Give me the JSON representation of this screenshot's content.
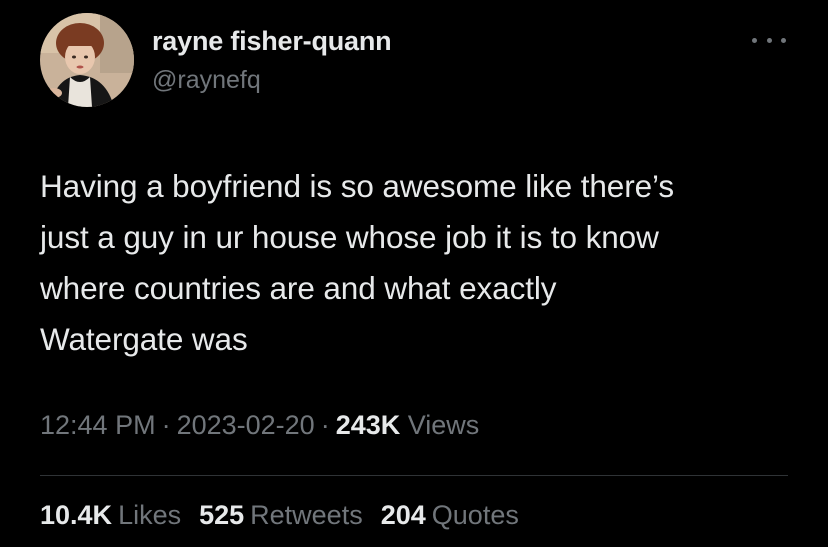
{
  "author": {
    "display_name": "rayne fisher-quann",
    "handle": "@raynefq",
    "avatar_icon": "profile-photo"
  },
  "more_icon": "ellipsis-icon",
  "tweet": {
    "lines": [
      "Having a boyfriend is so awesome like there’s",
      "just a guy in ur house whose job it is to know",
      "where countries are and what exactly",
      "Watergate was"
    ]
  },
  "meta": {
    "time": "12:44 PM",
    "separator": "·",
    "date": "2023-02-20",
    "views_count": "243K",
    "views_label": "Views"
  },
  "stats": {
    "likes_count": "10.4K",
    "likes_label": "Likes",
    "retweets_count": "525",
    "retweets_label": "Retweets",
    "quotes_count": "204",
    "quotes_label": "Quotes"
  },
  "colors": {
    "background": "#000000",
    "primary_text": "#e7e9ea",
    "secondary_text": "#71767b",
    "divider": "#2f3336"
  }
}
